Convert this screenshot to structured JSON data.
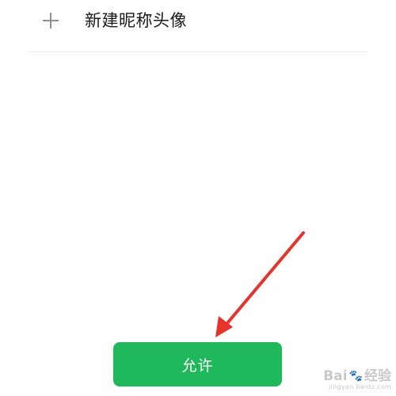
{
  "new_item": {
    "icon": "plus-icon",
    "label": "新建昵称头像"
  },
  "allow_button": {
    "label": "允许",
    "color": "#1fb85a"
  },
  "annotation": {
    "type": "red-arrow",
    "color": "#e8322a"
  },
  "watermark": {
    "brand_left": "Bai",
    "brand_right": "经验",
    "url": "jingyan.baidu.com"
  }
}
